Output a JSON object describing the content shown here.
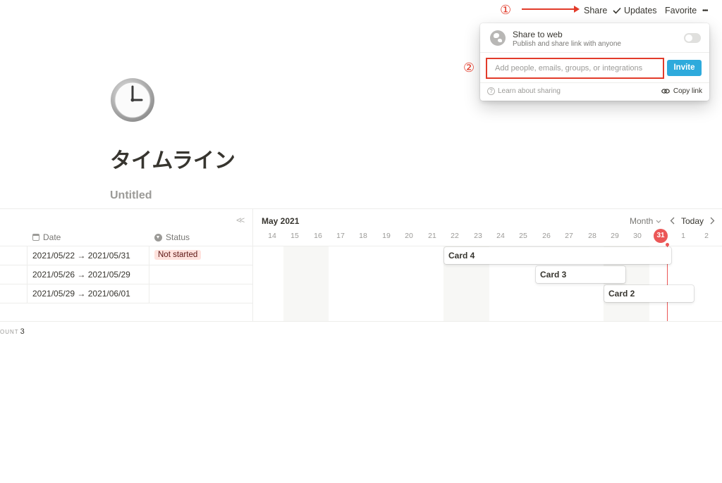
{
  "annotations": {
    "marker1": "①",
    "marker2": "②"
  },
  "topbar": {
    "share": "Share",
    "updates": "Updates",
    "favorite": "Favorite",
    "more": "•••"
  },
  "share_popup": {
    "title": "Share to web",
    "subtitle": "Publish and share link with anyone",
    "invite_placeholder": "Add people, emails, groups, or integrations",
    "invite_button": "Invite",
    "learn": "Learn about sharing",
    "copy_link": "Copy link",
    "share_to_web_enabled": false
  },
  "page": {
    "title": "タイムライン",
    "view_name": "Untitled"
  },
  "table": {
    "headers": {
      "date": "Date",
      "status": "Status"
    },
    "rows": [
      {
        "date": "2021/05/22 → 2021/05/31",
        "status": "Not started"
      },
      {
        "date": "2021/05/26 → 2021/05/29",
        "status": ""
      },
      {
        "date": "2021/05/29 → 2021/06/01",
        "status": ""
      }
    ],
    "count_label": "OUNT",
    "count_value": "3",
    "collapse": "<<"
  },
  "timeline": {
    "month": "May 2021",
    "zoom": "Month",
    "today": "Today",
    "days": [
      "14",
      "15",
      "16",
      "17",
      "18",
      "19",
      "20",
      "21",
      "22",
      "23",
      "24",
      "25",
      "26",
      "27",
      "28",
      "29",
      "30",
      "31",
      "1",
      "2"
    ],
    "today_day": "31",
    "cards": [
      "Card 4",
      "Card 3",
      "Card 2"
    ]
  },
  "colors": {
    "accent": "#2eaadc",
    "annotation": "#e23b2a",
    "today": "#eb5757",
    "badge_bg": "#ffe2dd"
  }
}
